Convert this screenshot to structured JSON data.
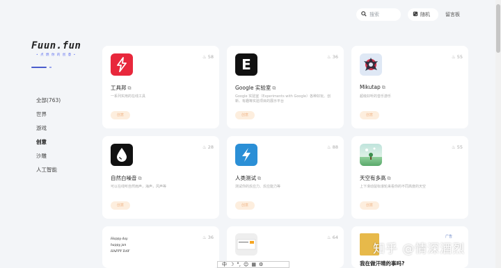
{
  "header": {
    "search_placeholder": "搜索",
    "random_label": "随机",
    "guestbook_label": "留言板"
  },
  "logo": {
    "text": "Fuun.fun",
    "subtitle": "• 点 燃 你 的 创 意 •"
  },
  "sidebar": {
    "items": [
      {
        "label": "全部(763)"
      },
      {
        "label": "世界"
      },
      {
        "label": "游戏"
      },
      {
        "label": "创意"
      },
      {
        "label": "沙雕"
      },
      {
        "label": "人工智能"
      }
    ]
  },
  "cards": [
    {
      "title": "工具邦",
      "hot": "58",
      "desc": "一系列实用的在线工具",
      "button": "创意",
      "icon": "lightning-red-icon"
    },
    {
      "title": "Google 实验室",
      "hot": "36",
      "desc": "Google 实验室（Experiments with Google）各种好玩、创新、有趣等实验项目的展示平台",
      "button": "创意",
      "icon": "letter-e-icon"
    },
    {
      "title": "Mikutap",
      "hot": "55",
      "desc": "超级好听的音乐游乐",
      "button": "创意",
      "icon": "mikutap-icon"
    },
    {
      "title": "自然白噪音",
      "hot": "28",
      "desc": "可以在线听自然雨声，海声，风声等",
      "button": "创意",
      "icon": "water-drop-icon"
    },
    {
      "title": "人类测试",
      "hot": "88",
      "desc": "测试你的反应力、反应能力等",
      "button": "创意",
      "icon": "lightning-blue-icon"
    },
    {
      "title": "天空有多高",
      "hot": "55",
      "desc": "上下滑动鼠标滚轮来看你的不同高度的天空",
      "button": "创意",
      "icon": "sky-icon"
    },
    {
      "title": "",
      "hot": "36",
      "desc": "",
      "button": "",
      "icon": "handwriting-icon",
      "lines": [
        "Happy day",
        "happy jan",
        "HAPPY DAY"
      ]
    },
    {
      "title": "",
      "hot": "64",
      "desc": "",
      "button": "",
      "icon": "screenshot-icon"
    },
    {
      "title": "我在做汗晴的事吗?",
      "hot": "",
      "desc": "",
      "button": "",
      "icon": "yellow-box-icon",
      "ad": "广告"
    }
  ],
  "watermark": "知乎 @情深酒烈",
  "ime": {
    "mode": "中"
  }
}
